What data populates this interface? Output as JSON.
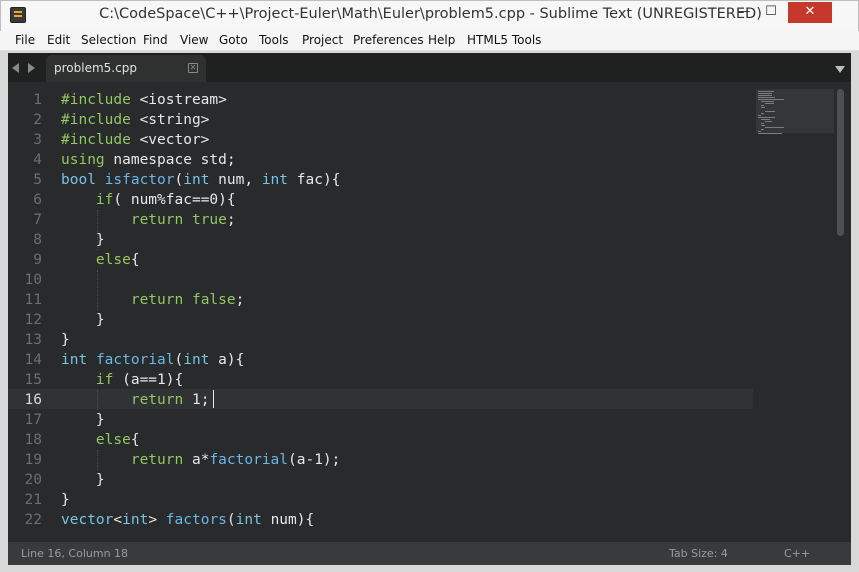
{
  "window": {
    "title": "C:\\CodeSpace\\C++\\Project-Euler\\Math\\Euler\\problem5.cpp - Sublime Text (UNREGISTERED)",
    "min_glyph": "—",
    "max_glyph": "☐",
    "close_glyph": "✕"
  },
  "menu": [
    "File",
    "Edit",
    "Selection",
    "Find",
    "View",
    "Goto",
    "Tools",
    "Project",
    "Preferences",
    "Help",
    "HTML5 Tools"
  ],
  "tabs": [
    {
      "label": "problem5.cpp",
      "close_glyph": "✕"
    }
  ],
  "editor": {
    "line_numbers": [
      "1",
      "2",
      "3",
      "4",
      "5",
      "6",
      "7",
      "8",
      "9",
      "10",
      "11",
      "12",
      "13",
      "14",
      "15",
      "16",
      "17",
      "18",
      "19",
      "20",
      "21",
      "22"
    ],
    "current_line": 16,
    "lines": [
      [
        [
          "t-kw",
          "#include"
        ],
        [
          "t-pl",
          " <iostream>"
        ]
      ],
      [
        [
          "t-kw",
          "#include"
        ],
        [
          "t-pl",
          " <string>"
        ]
      ],
      [
        [
          "t-kw",
          "#include"
        ],
        [
          "t-pl",
          " <vector>"
        ]
      ],
      [
        [
          "t-kw",
          "using"
        ],
        [
          "t-pl",
          " namespace std;"
        ]
      ],
      [
        [
          "t-ty",
          "bool"
        ],
        [
          "t-pl",
          " "
        ],
        [
          "t-fn",
          "isfactor"
        ],
        [
          "t-pl",
          "("
        ],
        [
          "t-ty",
          "int"
        ],
        [
          "t-pl",
          " num, "
        ],
        [
          "t-ty",
          "int"
        ],
        [
          "t-pl",
          " fac){"
        ]
      ],
      [
        [
          "t-pl",
          "    "
        ],
        [
          "t-kw",
          "if"
        ],
        [
          "t-pl",
          "( num%fac==0){"
        ]
      ],
      [
        [
          "t-pl",
          "        "
        ],
        [
          "t-kw",
          "return"
        ],
        [
          "t-pl",
          " "
        ],
        [
          "t-kw",
          "true"
        ],
        [
          "t-pl",
          ";"
        ]
      ],
      [
        [
          "t-pl",
          "    }"
        ]
      ],
      [
        [
          "t-pl",
          "    "
        ],
        [
          "t-kw",
          "else"
        ],
        [
          "t-pl",
          "{"
        ]
      ],
      [
        [
          "t-pl",
          ""
        ]
      ],
      [
        [
          "t-pl",
          "        "
        ],
        [
          "t-kw",
          "return"
        ],
        [
          "t-pl",
          " "
        ],
        [
          "t-kw",
          "false"
        ],
        [
          "t-pl",
          ";"
        ]
      ],
      [
        [
          "t-pl",
          "    }"
        ]
      ],
      [
        [
          "t-pl",
          "}"
        ]
      ],
      [
        [
          "t-ty",
          "int"
        ],
        [
          "t-pl",
          " "
        ],
        [
          "t-fn",
          "factorial"
        ],
        [
          "t-pl",
          "("
        ],
        [
          "t-ty",
          "int"
        ],
        [
          "t-pl",
          " a){"
        ]
      ],
      [
        [
          "t-pl",
          "    "
        ],
        [
          "t-kw",
          "if"
        ],
        [
          "t-pl",
          " (a==1){"
        ]
      ],
      [
        [
          "t-pl",
          "        "
        ],
        [
          "t-kw",
          "return"
        ],
        [
          "t-pl",
          " 1;"
        ]
      ],
      [
        [
          "t-pl",
          "    }"
        ]
      ],
      [
        [
          "t-pl",
          "    "
        ],
        [
          "t-kw",
          "else"
        ],
        [
          "t-pl",
          "{"
        ]
      ],
      [
        [
          "t-pl",
          "        "
        ],
        [
          "t-kw",
          "return"
        ],
        [
          "t-pl",
          " a*"
        ],
        [
          "t-fn",
          "factorial"
        ],
        [
          "t-pl",
          "(a-1);"
        ]
      ],
      [
        [
          "t-pl",
          "    }"
        ]
      ],
      [
        [
          "t-pl",
          "}"
        ]
      ],
      [
        [
          "t-ty",
          "vector"
        ],
        [
          "t-pl",
          "<"
        ],
        [
          "t-ty",
          "int"
        ],
        [
          "t-pl",
          "> "
        ],
        [
          "t-fn",
          "factors"
        ],
        [
          "t-pl",
          "("
        ],
        [
          "t-ty",
          "int"
        ],
        [
          "t-pl",
          " num){"
        ]
      ]
    ]
  },
  "status": {
    "position": "Line 16, Column 18",
    "tab_size": "Tab Size: 4",
    "syntax": "C++"
  },
  "colors": {
    "editor_bg": "#282a2b",
    "keyword": "#93c763",
    "type": "#78c3e6",
    "function": "#6bb7e6",
    "text": "#e8e8e8",
    "close_button": "#c7382c"
  }
}
